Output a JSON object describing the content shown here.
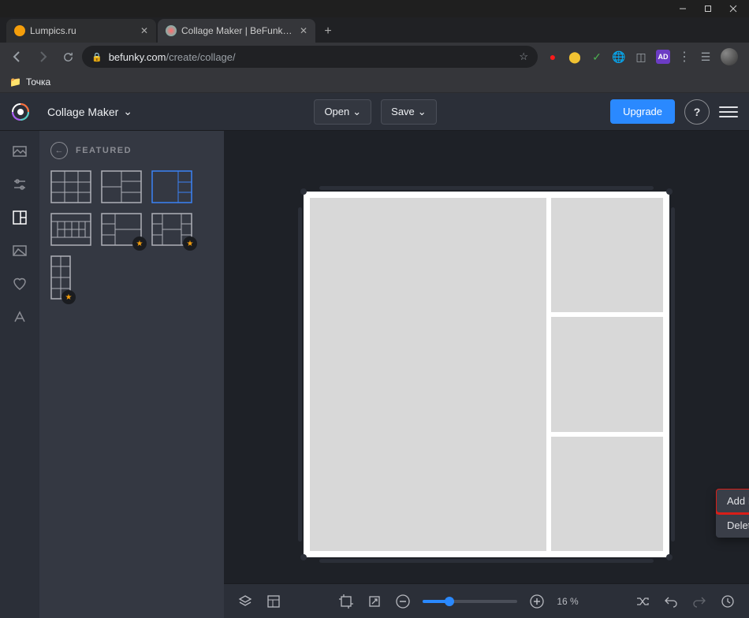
{
  "window_controls": {
    "minimize": "—",
    "maximize": "☐",
    "close": "✕"
  },
  "tabs": [
    {
      "title": "Lumpics.ru"
    },
    {
      "title": "Collage Maker | BeFunky: Create"
    }
  ],
  "url": {
    "domain": "befunky.com",
    "path": "/create/collage/"
  },
  "bookmarks": {
    "folder": "Точка"
  },
  "app": {
    "title": "Collage Maker",
    "open": "Open",
    "save": "Save",
    "upgrade": "Upgrade",
    "help": "?"
  },
  "panel": {
    "title": "FEATURED"
  },
  "context_menu": {
    "add_image": "Add Image",
    "delete_cell": "Delete Cell"
  },
  "footer": {
    "zoom_pct": "16 %"
  }
}
